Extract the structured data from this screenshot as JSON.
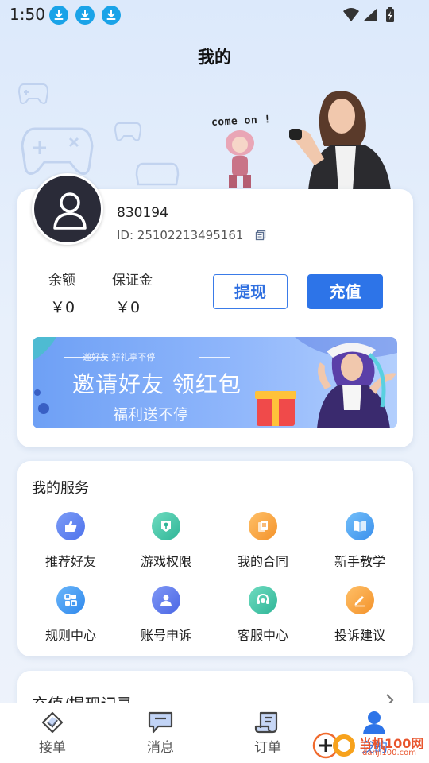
{
  "status_bar": {
    "time": "1:50",
    "download_icons": [
      "download-icon",
      "download-icon",
      "download-icon"
    ],
    "system_icons": [
      "wifi-icon",
      "signal-icon",
      "battery-charging-icon"
    ]
  },
  "header": {
    "title": "我的"
  },
  "banner": {
    "caption": "come on !"
  },
  "profile": {
    "username": "830194",
    "id_text": "ID: 25102213495161",
    "balances": [
      {
        "label": "余额",
        "value": "￥0"
      },
      {
        "label": "保证金",
        "value": "￥0"
      }
    ],
    "withdraw_label": "提现",
    "recharge_label": "充值"
  },
  "invite": {
    "small_text": "邀好友 好礼享不停",
    "title": "邀请好友 领红包",
    "subtitle": "福利送不停"
  },
  "services": {
    "title": "我的服务",
    "items": [
      {
        "label": "推荐好友",
        "icon": "thumbs-up-icon",
        "color": "#5b82f0"
      },
      {
        "label": "游戏权限",
        "icon": "key-icon",
        "color": "#3cc3a5"
      },
      {
        "label": "我的合同",
        "icon": "contract-icon",
        "color": "#f5a43a"
      },
      {
        "label": "新手教学",
        "icon": "book-icon",
        "color": "#4aa3ef"
      },
      {
        "label": "规则中心",
        "icon": "rules-icon",
        "color": "#3c9ff0"
      },
      {
        "label": "账号申诉",
        "icon": "user-appeal-icon",
        "color": "#5a7af0"
      },
      {
        "label": "客服中心",
        "icon": "headset-icon",
        "color": "#3cc3a5"
      },
      {
        "label": "投诉建议",
        "icon": "pencil-icon",
        "color": "#f5a43a"
      }
    ]
  },
  "records": {
    "title": "充值/提现记录"
  },
  "tabbar": {
    "items": [
      {
        "label": "接单",
        "icon": "diamond-check-icon"
      },
      {
        "label": "消息",
        "icon": "message-icon"
      },
      {
        "label": "订单",
        "icon": "scroll-icon"
      },
      {
        "label": "我的",
        "icon": "person-icon"
      }
    ],
    "active_color": "#2d74e8"
  },
  "watermark": {
    "text": "当机100网",
    "url": "danji100.com"
  }
}
